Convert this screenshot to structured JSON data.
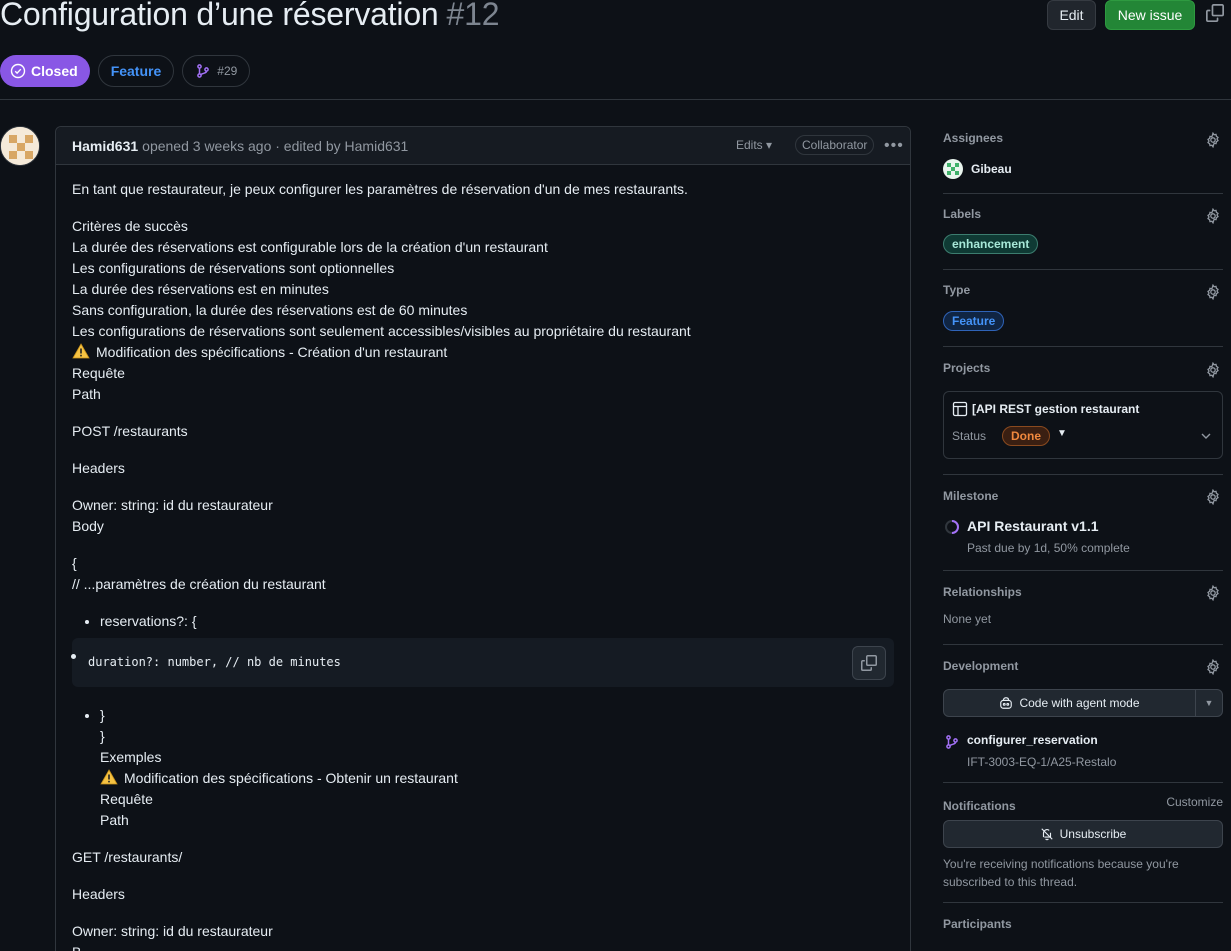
{
  "issue": {
    "title": "Configuration d’une réservation",
    "number": "#12",
    "state": "Closed",
    "type_badge": "Feature",
    "linked_pr": "#29"
  },
  "header_buttons": {
    "edit": "Edit",
    "new_issue": "New issue"
  },
  "comment": {
    "author": "Hamid631",
    "meta": "opened 3 weeks ago · edited by Hamid631",
    "edits": "Edits",
    "role": "Collaborator",
    "intro": "En tant que restaurateur, je peux configurer les paramètres de réservation d'un de mes restaurants.",
    "criteria": [
      "Critères de succès",
      "La durée des réservations est configurable lors de la création d'un restaurant",
      "Les configurations de réservations sont optionnelles",
      "La durée des réservations est en minutes",
      "Sans configuration, la durée des réservations est de 60 minutes",
      "Les configurations de réservations sont seulement accessibles/visibles au propriétaire du restaurant"
    ],
    "mod1": "Modification des spécifications - Création d'un restaurant",
    "request": "Requête",
    "path": "Path",
    "post": "POST /restaurants",
    "headers": "Headers",
    "owner": "Owner: string: id du restaurateur",
    "body": "Body",
    "brace_open": "{",
    "comment_line": "// ...paramètres de création du restaurant",
    "reservations": "reservations?: {",
    "code": "duration?: number, // nb de minutes",
    "brace_close1": "}",
    "brace_close2": "}",
    "examples": "Exemples",
    "mod2": "Modification des spécifications - Obtenir un restaurant",
    "request2": "Requête",
    "path2": "Path",
    "get": "GET /restaurants/",
    "headers2": "Headers",
    "owner2": "Owner: string: id du restaurateur",
    "body2": "B..."
  },
  "sidebar": {
    "assignees_title": "Assignees",
    "assignee": "Gibeau",
    "labels_title": "Labels",
    "label": "enhancement",
    "type_title": "Type",
    "type": "Feature",
    "projects_title": "Projects",
    "project_name": "[API REST gestion restaurant",
    "status_label": "Status",
    "status_value": "Done",
    "milestone_title": "Milestone",
    "milestone_name": "API Restaurant v1.1",
    "milestone_meta": "Past due by 1d, 50% complete",
    "relationships_title": "Relationships",
    "relationships_value": "None yet",
    "development_title": "Development",
    "agent_button": "Code with agent mode",
    "branch_name": "configurer_reservation",
    "branch_repo": "IFT-3003-EQ-1/A25-Restalo",
    "notifications_title": "Notifications",
    "customize": "Customize",
    "unsubscribe": "Unsubscribe",
    "notif_text": "You're receiving notifications because you're subscribed to this thread.",
    "participants_title": "Participants"
  },
  "colors": {
    "accent": "#4493f8",
    "closed": "#8957e5",
    "new_issue": "#238636",
    "done": "#f0883e"
  }
}
